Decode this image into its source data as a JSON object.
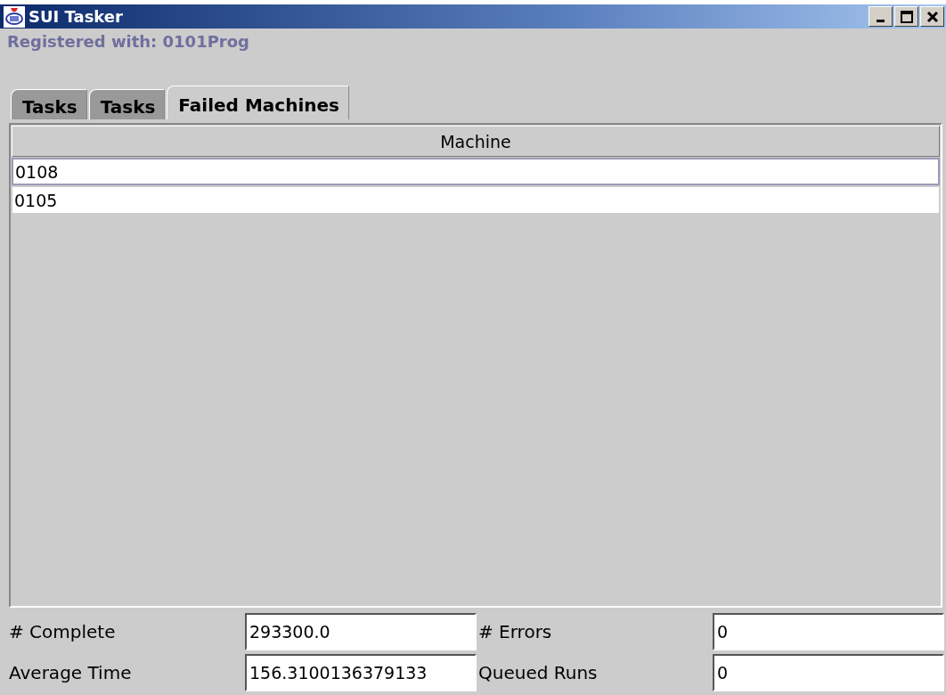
{
  "window": {
    "title": "SUI Tasker"
  },
  "registration": "Registered with: 0101Prog",
  "tabs": [
    {
      "label": "Tasks",
      "selected": false
    },
    {
      "label": "Tasks",
      "selected": false
    },
    {
      "label": "Failed Machines",
      "selected": true
    }
  ],
  "table": {
    "columns": [
      "Machine"
    ],
    "rows": [
      {
        "cells": [
          "0108"
        ],
        "selected": true
      },
      {
        "cells": [
          "0105"
        ],
        "selected": false
      }
    ]
  },
  "stats": [
    {
      "label": "# Complete",
      "value": "293300.0"
    },
    {
      "label": "# Errors",
      "value": "0"
    },
    {
      "label": "Average Time",
      "value": "156.3100136379133"
    },
    {
      "label": "Queued Runs",
      "value": "0"
    }
  ]
}
